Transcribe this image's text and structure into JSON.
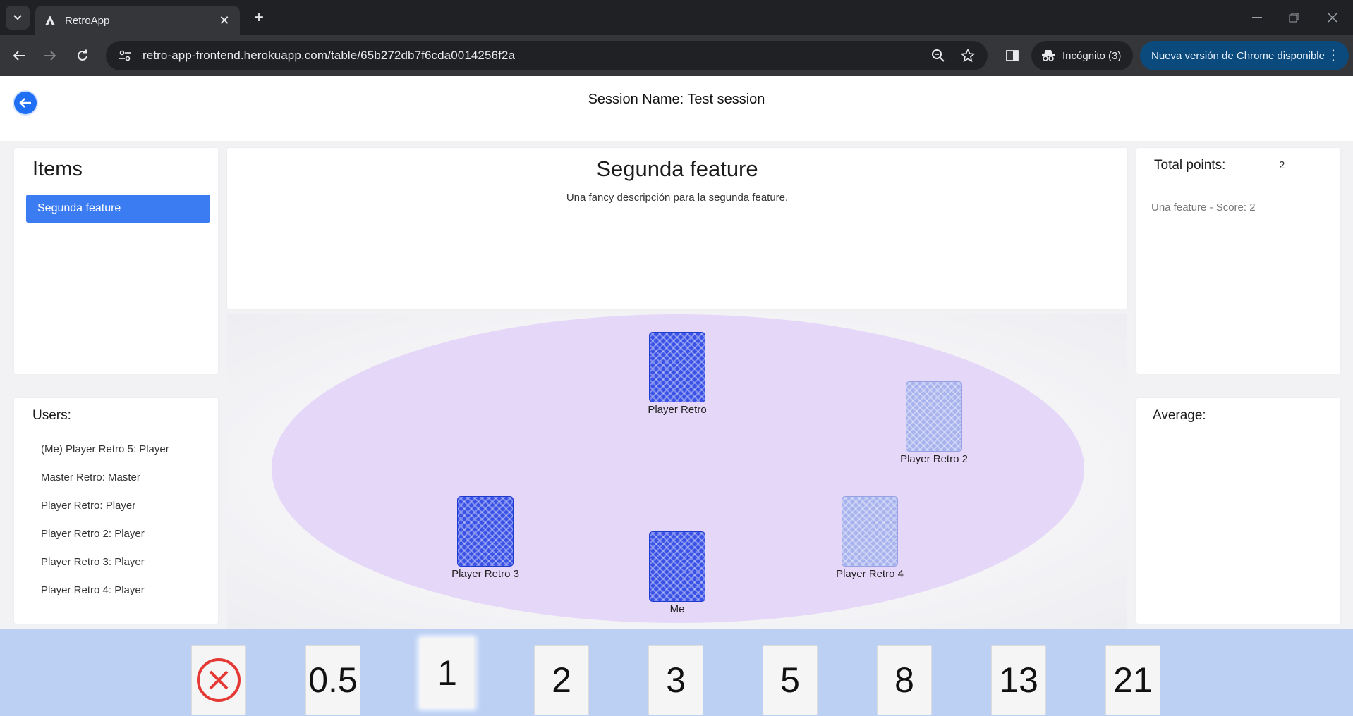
{
  "browser": {
    "tab_title": "RetroApp",
    "url": "retro-app-frontend.herokuapp.com/table/65b272db7f6cda0014256f2a",
    "incognito_label": "Incógnito (3)",
    "update_label": "Nueva versión de Chrome disponible"
  },
  "header": {
    "session_title": "Session Name: Test session"
  },
  "items": {
    "title": "Items",
    "list": [
      "Segunda feature"
    ]
  },
  "users": {
    "title": "Users:",
    "list": [
      "(Me) Player Retro 5: Player",
      "Master Retro: Master",
      "Player Retro: Player",
      "Player Retro 2: Player",
      "Player Retro 3: Player",
      "Player Retro 4: Player"
    ]
  },
  "feature": {
    "title": "Segunda feature",
    "description": "Una fancy descripción para la segunda feature."
  },
  "points": {
    "label": "Total points:",
    "value": "2",
    "entries": [
      "Una feature - Score: 2"
    ]
  },
  "average": {
    "label": "Average:"
  },
  "table": {
    "players": [
      {
        "name": "Player Retro",
        "card_state": "dark"
      },
      {
        "name": "Player Retro 2",
        "card_state": "light"
      },
      {
        "name": "Player Retro 3",
        "card_state": "dark"
      },
      {
        "name": "Me",
        "card_state": "dark"
      },
      {
        "name": "Player Retro 4",
        "card_state": "light"
      }
    ]
  },
  "deck": {
    "cards": [
      "cancel-icon",
      "0.5",
      "1",
      "2",
      "3",
      "5",
      "8",
      "13",
      "21"
    ],
    "selected": "1"
  },
  "colors": {
    "accent": "#3b7cf2",
    "table": "#e5d7f8",
    "deck_bg": "#bcd0f4",
    "cancel_red": "#e53935"
  }
}
